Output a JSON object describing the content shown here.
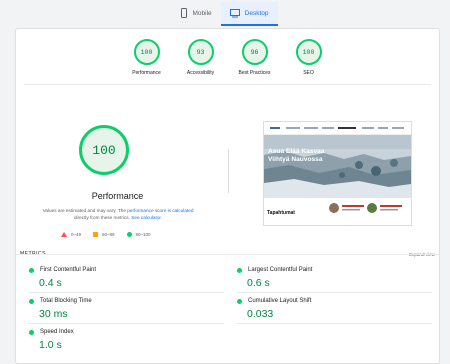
{
  "tabs": [
    {
      "label": "Mobile",
      "icon": "mobile-icon",
      "active": false
    },
    {
      "label": "Desktop",
      "icon": "desktop-icon",
      "active": true
    }
  ],
  "gauges": [
    {
      "score": "100",
      "label": "Performance"
    },
    {
      "score": "93",
      "label": "Accessibility"
    },
    {
      "score": "96",
      "label": "Best Practices"
    },
    {
      "score": "100",
      "label": "SEO"
    }
  ],
  "performance": {
    "score": "100",
    "title": "Performance",
    "note_pre": "Values are estimated and may vary. The",
    "note_link1": "performance score is calculated",
    "note_mid": "directly from these metrics.",
    "note_link2": "See calculator."
  },
  "legend": [
    {
      "range": "0–49",
      "shape": "triangle",
      "color": "#ff4e42"
    },
    {
      "range": "50–89",
      "shape": "square",
      "color": "#ffa400"
    },
    {
      "range": "90–100",
      "shape": "circle",
      "color": "#0cce6b"
    }
  ],
  "screenshot": {
    "hero_text": "Asua Elää Kasvaa Viihtyä Nauvossa",
    "section_heading": "Tapahtumat"
  },
  "metrics": {
    "header": "METRICS",
    "expand_label": "Expand view",
    "items": [
      {
        "name": "First Contentful Paint",
        "value": "0.4 s"
      },
      {
        "name": "Largest Contentful Paint",
        "value": "0.6 s"
      },
      {
        "name": "Total Blocking Time",
        "value": "30 ms"
      },
      {
        "name": "Cumulative Layout Shift",
        "value": "0.033"
      },
      {
        "name": "Speed Index",
        "value": "1.0 s"
      }
    ]
  },
  "colors": {
    "pass": "#0cce6b",
    "pass_text": "#018642",
    "accent": "#1a73e8"
  }
}
